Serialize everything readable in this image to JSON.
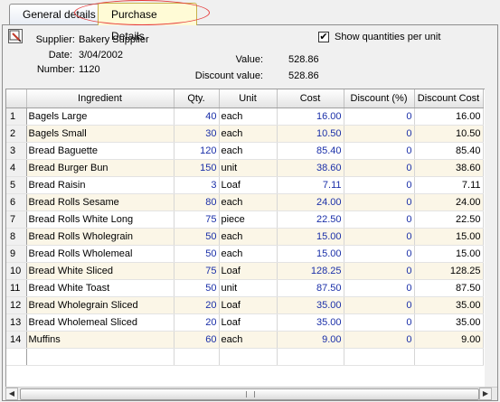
{
  "tabs": [
    {
      "label": "General details"
    },
    {
      "label": "Purchase Details"
    }
  ],
  "header": {
    "supplier_label": "Supplier:",
    "supplier_value": "Bakery Supplier",
    "date_label": "Date:",
    "date_value": "3/04/2002",
    "number_label": "Number:",
    "number_value": "1120",
    "value_label": "Value:",
    "value_value": "528.86",
    "discount_value_label": "Discount value:",
    "discount_value_value": "528.86",
    "show_qty_label": "Show quantities per unit",
    "show_qty_checked": "✔"
  },
  "grid": {
    "columns": [
      "Ingredient",
      "Qty.",
      "Unit",
      "Cost",
      "Discount (%)",
      "Discount Cost"
    ],
    "rows": [
      {
        "n": "1",
        "ingredient": "Bagels Large",
        "qty": "40",
        "unit": "each",
        "cost": "16.00",
        "disc": "0",
        "dcost": "16.00"
      },
      {
        "n": "2",
        "ingredient": "Bagels Small",
        "qty": "30",
        "unit": "each",
        "cost": "10.50",
        "disc": "0",
        "dcost": "10.50"
      },
      {
        "n": "3",
        "ingredient": "Bread Baguette",
        "qty": "120",
        "unit": "each",
        "cost": "85.40",
        "disc": "0",
        "dcost": "85.40"
      },
      {
        "n": "4",
        "ingredient": "Bread Burger Bun",
        "qty": "150",
        "unit": "unit",
        "cost": "38.60",
        "disc": "0",
        "dcost": "38.60"
      },
      {
        "n": "5",
        "ingredient": "Bread Raisin",
        "qty": "3",
        "unit": "Loaf",
        "cost": "7.11",
        "disc": "0",
        "dcost": "7.11"
      },
      {
        "n": "6",
        "ingredient": "Bread Rolls Sesame",
        "qty": "80",
        "unit": "each",
        "cost": "24.00",
        "disc": "0",
        "dcost": "24.00"
      },
      {
        "n": "7",
        "ingredient": "Bread Rolls White Long",
        "qty": "75",
        "unit": "piece",
        "cost": "22.50",
        "disc": "0",
        "dcost": "22.50"
      },
      {
        "n": "8",
        "ingredient": "Bread Rolls Wholegrain",
        "qty": "50",
        "unit": "each",
        "cost": "15.00",
        "disc": "0",
        "dcost": "15.00"
      },
      {
        "n": "9",
        "ingredient": "Bread Rolls Wholemeal",
        "qty": "50",
        "unit": "each",
        "cost": "15.00",
        "disc": "0",
        "dcost": "15.00"
      },
      {
        "n": "10",
        "ingredient": "Bread White Sliced",
        "qty": "75",
        "unit": "Loaf",
        "cost": "128.25",
        "disc": "0",
        "dcost": "128.25"
      },
      {
        "n": "11",
        "ingredient": "Bread White Toast",
        "qty": "50",
        "unit": "unit",
        "cost": "87.50",
        "disc": "0",
        "dcost": "87.50"
      },
      {
        "n": "12",
        "ingredient": "Bread Wholegrain Sliced",
        "qty": "20",
        "unit": "Loaf",
        "cost": "35.00",
        "disc": "0",
        "dcost": "35.00"
      },
      {
        "n": "13",
        "ingredient": "Bread Wholemeal Sliced",
        "qty": "20",
        "unit": "Loaf",
        "cost": "35.00",
        "disc": "0",
        "dcost": "35.00"
      },
      {
        "n": "14",
        "ingredient": "Muffins",
        "qty": "60",
        "unit": "each",
        "cost": "9.00",
        "disc": "0",
        "dcost": "9.00"
      }
    ]
  },
  "scrollbar": {
    "left_arrow": "◀",
    "right_arrow": "▶"
  },
  "colors": {
    "value_blue": "#1a2fa8",
    "row_alt": "#fbf6e7",
    "active_tab": "#fffbd6",
    "highlight_ring": "#e53a3a"
  }
}
